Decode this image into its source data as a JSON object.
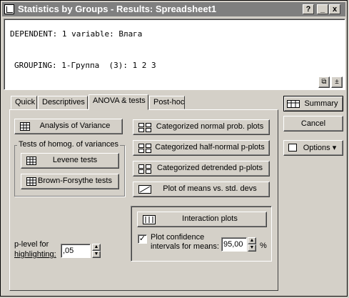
{
  "window": {
    "title": "Statistics by Groups - Results: Spreadsheet1"
  },
  "titlebar_buttons": {
    "help": "?",
    "minimize": "_",
    "close": "x"
  },
  "info": {
    "dependent_line": "DEPENDENT: 1 variable: Влага",
    "grouping_line": "GROUPING: 1-Группа  (3): 1 2 3",
    "copy_btn": "⧉",
    "up_btn": "±"
  },
  "tabs": [
    "Quick",
    "Descriptives",
    "ANOVA & tests",
    "Post-hoc"
  ],
  "active_tab": "ANOVA & tests",
  "anova": {
    "analysis_of_variance": "Analysis of Variance",
    "homog_group_label": "Tests of homog. of variances",
    "levene": "Levene tests",
    "brown_forsythe": "Brown-Forsythe tests",
    "cat_normal": "Categorized normal prob. plots",
    "cat_half_normal": "Categorized half-normal p-plots",
    "cat_detrended": "Categorized detrended  p-plots",
    "plot_means_std": "Plot of means vs. std. devs",
    "interaction_plots": "Interaction plots",
    "plot_ci_label_1": "Plot confidence",
    "plot_ci_label_2": "intervals for means:",
    "plot_ci_checked": true,
    "ci_value": "95,00",
    "ci_unit": "%",
    "plevel_label_1": "p-level for",
    "plevel_label_2": "highlighting:",
    "plevel_value": ",05"
  },
  "side": {
    "summary": "Summary",
    "cancel": "Cancel",
    "options": "Options ▾"
  },
  "colors": {
    "titlebar": "#7f7f7f",
    "face": "#d4d0c8"
  }
}
